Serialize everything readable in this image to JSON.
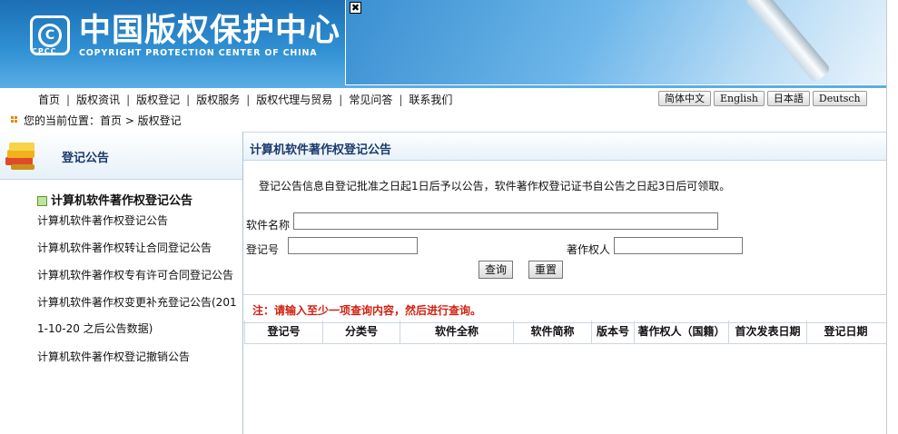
{
  "header": {
    "logo_abbr": "CPCC",
    "logo_mark": "C",
    "title": "中国版权保护中心",
    "subtitle": "COPYRIGHT PROTECTION CENTER OF CHINA",
    "close_glyph": "✖"
  },
  "nav": {
    "items": [
      "首页",
      "版权资讯",
      "版权登记",
      "版权服务",
      "版权代理与贸易",
      "常见问答",
      "联系我们"
    ],
    "separator": "|"
  },
  "languages": [
    "简体中文",
    "English",
    "日本語",
    "Deutsch"
  ],
  "breadcrumb": "您的当前位置：首页 > 版权登记",
  "sidebar": {
    "title": "登记公告",
    "active": "计算机软件著作权登记公告",
    "items": [
      "计算机软件著作权登记公告",
      "计算机软件著作权转让合同登记公告",
      "计算机软件著作权专有许可合同登记公告",
      "计算机软件著作权变更补充登记公告(201",
      "1-10-20 之后公告数据)",
      "计算机软件著作权登记撤销公告"
    ]
  },
  "main": {
    "title": "计算机软件著作权登记公告",
    "notice": "登记公告信息自登记批准之日起1日后予以公告，软件著作权登记证书自公告之日起3日后可领取。",
    "form": {
      "software_name_label": "软件名称",
      "software_name_value": "",
      "reg_no_label": "登记号",
      "reg_no_value": "",
      "owner_label": "著作权人",
      "owner_value": "",
      "query_button": "查询",
      "reset_button": "重置"
    },
    "hint": "注：请输入至少一项查询内容，然后进行查询。",
    "table": {
      "columns": [
        "登记号",
        "分类号",
        "软件全称",
        "软件简称",
        "版本号",
        "著作权人（国籍）",
        "首次发表日期",
        "登记日期"
      ],
      "rows": []
    }
  },
  "colors": {
    "header_blue": "#2f8fd2",
    "title_navy": "#1a3a6a",
    "hint_red": "#d02010"
  }
}
